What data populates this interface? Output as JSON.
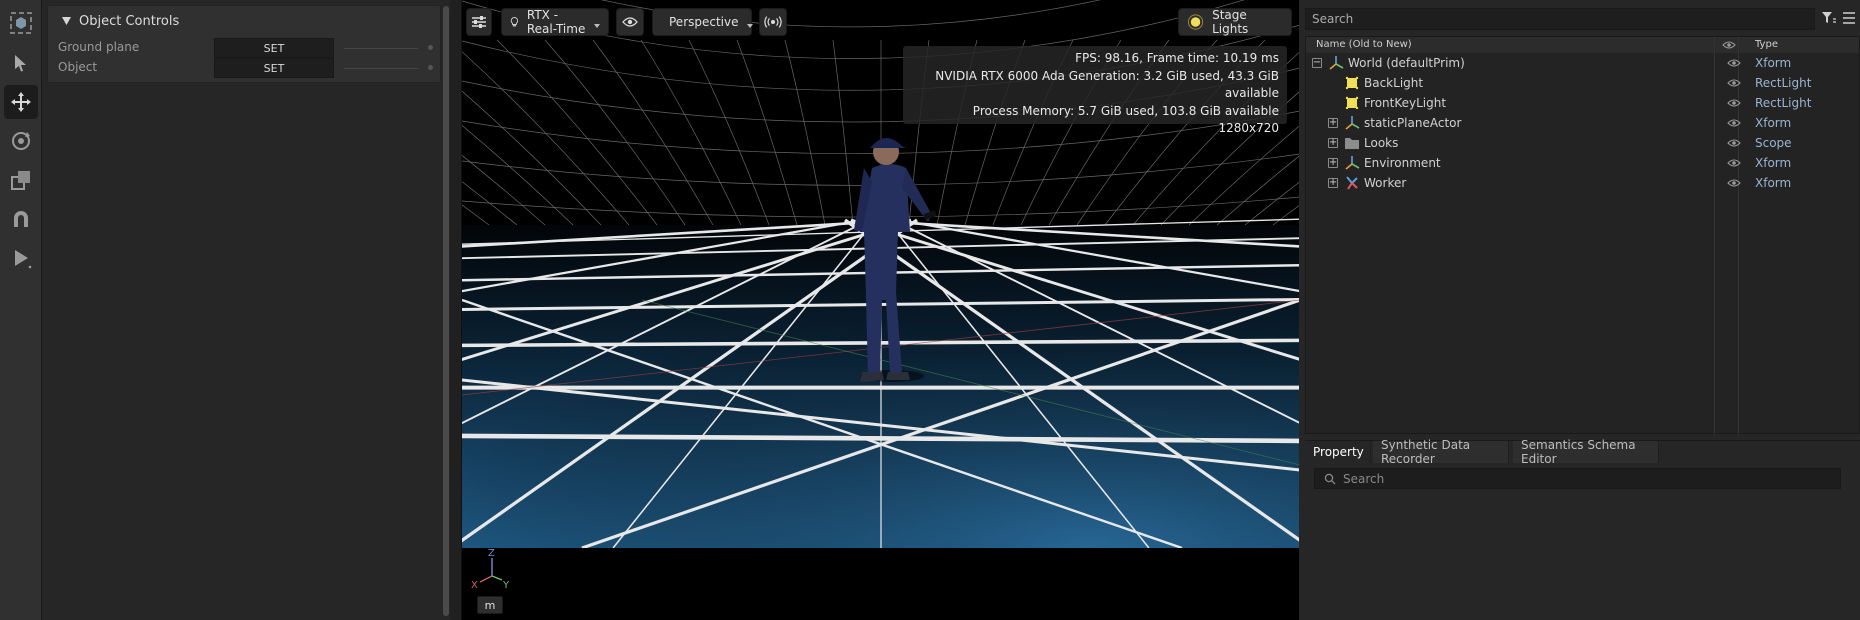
{
  "toolbar": {
    "tools": [
      {
        "name": "layout-icon"
      },
      {
        "name": "select-arrow-icon"
      },
      {
        "name": "move-icon",
        "active": true
      },
      {
        "name": "rotate-icon"
      },
      {
        "name": "scale-icon"
      },
      {
        "name": "snap-magnet-icon"
      },
      {
        "name": "play-icon"
      }
    ]
  },
  "object_controls": {
    "title": "Object Controls",
    "rows": [
      {
        "label": "Ground plane",
        "button": "SET"
      },
      {
        "label": "Object",
        "button": "SET"
      }
    ]
  },
  "viewport": {
    "renderer_label": "RTX - Real-Time",
    "camera_label": "Perspective",
    "lights_label": "Stage Lights",
    "stats": [
      "FPS: 98.16, Frame time: 10.19 ms",
      "NVIDIA RTX 6000 Ada Generation: 3.2 GiB used, 43.3 GiB available",
      "Process Memory: 5.7 GiB used, 103.8 GiB available",
      "1280x720"
    ],
    "axis_labels": {
      "z": "Z",
      "x": "X",
      "y": "Y"
    },
    "unit_button": "m"
  },
  "stage": {
    "search_placeholder": "Search",
    "columns": {
      "name": "Name (Old to New)",
      "type": "Type"
    },
    "items": [
      {
        "name": "World (defaultPrim)",
        "type": "Xform",
        "icon": "xform-icon",
        "expander": "−"
      },
      {
        "name": "BackLight",
        "type": "RectLight",
        "icon": "light-icon",
        "expander": ""
      },
      {
        "name": "FrontKeyLight",
        "type": "RectLight",
        "icon": "light-icon",
        "expander": ""
      },
      {
        "name": "staticPlaneActor",
        "type": "Xform",
        "icon": "xform-icon",
        "expander": "+"
      },
      {
        "name": "Looks",
        "type": "Scope",
        "icon": "folder-icon",
        "expander": "+"
      },
      {
        "name": "Environment",
        "type": "Xform",
        "icon": "xform-icon",
        "expander": "+"
      },
      {
        "name": "Worker",
        "type": "Xform",
        "icon": "skeleton-icon",
        "expander": "+"
      }
    ]
  },
  "property": {
    "tabs": [
      "Property",
      "Synthetic Data Recorder",
      "Semantics Schema Editor"
    ],
    "search_placeholder": "Search"
  },
  "colors": {
    "accent_type": "#9bb5d0",
    "light_yellow": "#f2df59",
    "floor_blue": "#1f4f78"
  }
}
